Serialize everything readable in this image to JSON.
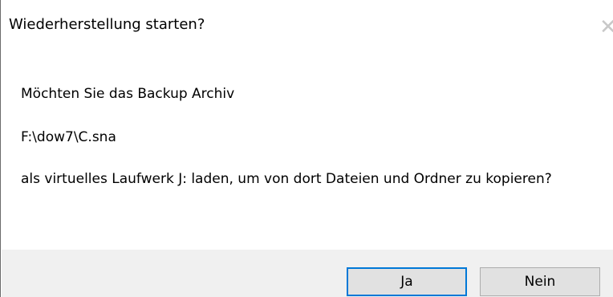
{
  "window": {
    "title": "Wiederherstellung starten?",
    "close_icon": "close-icon"
  },
  "message": {
    "line1": "Möchten Sie das Backup Archiv",
    "line2": "F:\\dow7\\C.sna",
    "line3": "als virtuelles Laufwerk J: laden, um von dort Dateien und Ordner zu kopieren?"
  },
  "buttons": {
    "yes_label": "Ja",
    "no_label": "Nein"
  },
  "colors": {
    "footer_bg": "#f0f0f0",
    "default_button_border": "#0078d7",
    "button_bg": "#e1e1e1"
  }
}
